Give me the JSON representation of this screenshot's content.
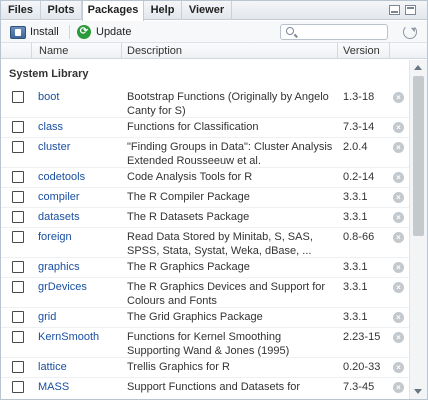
{
  "tabs": [
    {
      "label": "Files",
      "active": false
    },
    {
      "label": "Plots",
      "active": false
    },
    {
      "label": "Packages",
      "active": true
    },
    {
      "label": "Help",
      "active": false
    },
    {
      "label": "Viewer",
      "active": false
    }
  ],
  "toolbar": {
    "install_label": "Install",
    "update_label": "Update",
    "search_value": "",
    "search_placeholder": ""
  },
  "columns": {
    "name": "Name",
    "description": "Description",
    "version": "Version"
  },
  "section_title": "System Library",
  "packages": [
    {
      "name": "boot",
      "description": "Bootstrap Functions (Originally by Angelo Canty for S)",
      "version": "1.3-18",
      "checked": false
    },
    {
      "name": "class",
      "description": "Functions for Classification",
      "version": "7.3-14",
      "checked": false
    },
    {
      "name": "cluster",
      "description": "\"Finding Groups in Data\": Cluster Analysis Extended Rousseeuw et al.",
      "version": "2.0.4",
      "checked": false
    },
    {
      "name": "codetools",
      "description": "Code Analysis Tools for R",
      "version": "0.2-14",
      "checked": false
    },
    {
      "name": "compiler",
      "description": "The R Compiler Package",
      "version": "3.3.1",
      "checked": false
    },
    {
      "name": "datasets",
      "description": "The R Datasets Package",
      "version": "3.3.1",
      "checked": false
    },
    {
      "name": "foreign",
      "description": "Read Data Stored by Minitab, S, SAS, SPSS, Stata, Systat, Weka, dBase, ...",
      "version": "0.8-66",
      "checked": false
    },
    {
      "name": "graphics",
      "description": "The R Graphics Package",
      "version": "3.3.1",
      "checked": false
    },
    {
      "name": "grDevices",
      "description": "The R Graphics Devices and Support for Colours and Fonts",
      "version": "3.3.1",
      "checked": false
    },
    {
      "name": "grid",
      "description": "The Grid Graphics Package",
      "version": "3.3.1",
      "checked": false
    },
    {
      "name": "KernSmooth",
      "description": "Functions for Kernel Smoothing Supporting Wand & Jones (1995)",
      "version": "2.23-15",
      "checked": false
    },
    {
      "name": "lattice",
      "description": "Trellis Graphics for R",
      "version": "0.20-33",
      "checked": false
    },
    {
      "name": "MASS",
      "description": "Support Functions and Datasets for",
      "version": "7.3-45",
      "checked": false
    }
  ],
  "icons": {
    "install": "install-icon",
    "update": "update-icon",
    "search": "search-icon",
    "refresh": "refresh-icon",
    "remove": "remove-icon",
    "minimize": "minimize-icon",
    "maximize": "maximize-icon"
  },
  "colors": {
    "link": "#1a4fa0",
    "update_green": "#2a9a3a",
    "border": "#b8c4d0"
  }
}
